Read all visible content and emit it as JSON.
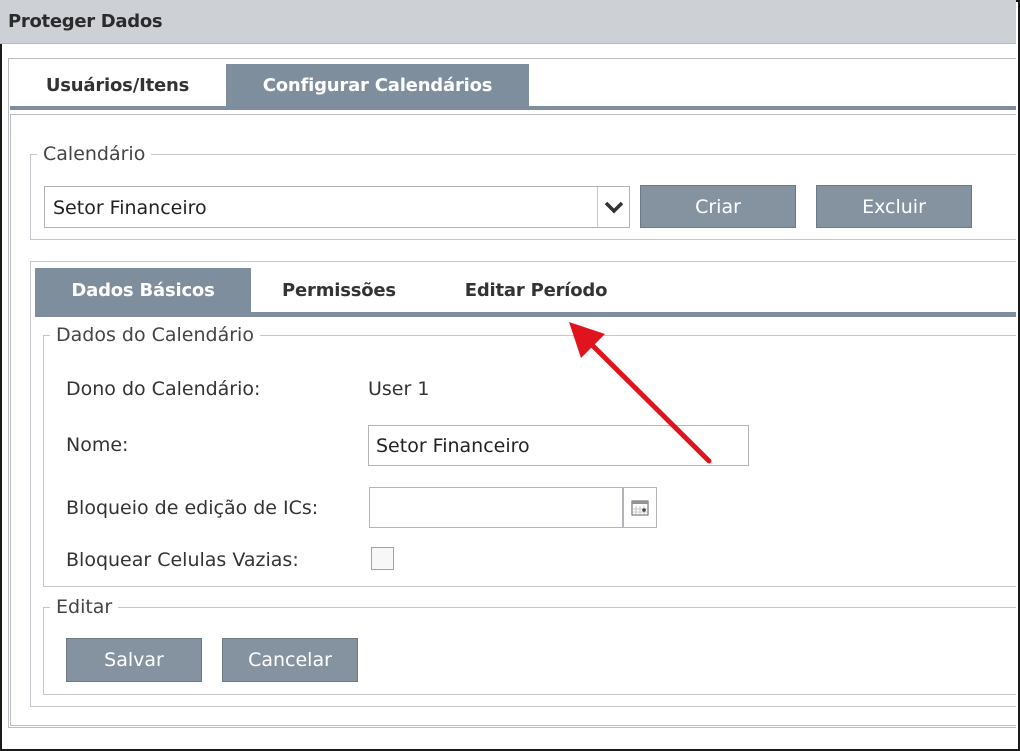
{
  "window": {
    "title": "Proteger Dados"
  },
  "tabs": [
    {
      "label": "Usuários/Itens",
      "active": false
    },
    {
      "label": "Configurar Calendários",
      "active": true
    }
  ],
  "calendar_group": {
    "legend": "Calendário",
    "selected": "Setor Financeiro",
    "create_label": "Criar",
    "delete_label": "Excluir"
  },
  "subtabs": [
    {
      "label": "Dados Básicos",
      "active": true
    },
    {
      "label": "Permissões",
      "active": false
    },
    {
      "label": "Editar Período",
      "active": false
    }
  ],
  "calendar_data": {
    "legend": "Dados do Calendário",
    "owner_label": "Dono do Calendário:",
    "owner_value": "User 1",
    "name_label": "Nome:",
    "name_value": "Setor Financeiro",
    "lock_label": "Bloqueio de edição de ICs:",
    "lock_value": "",
    "empty_cells_label": "Bloquear Celulas Vazias:",
    "empty_cells_checked": false
  },
  "edit_group": {
    "legend": "Editar",
    "save_label": "Salvar",
    "cancel_label": "Cancelar"
  },
  "colors": {
    "tab_active": "#7e8e9d",
    "button": "#8593a0",
    "titlebar": "#cdd0d4",
    "annotation_arrow": "#e0141c"
  },
  "icons": {
    "dropdown": "chevron-down-icon",
    "date_picker": "calendar-icon",
    "annotation": "red-arrow-icon"
  }
}
